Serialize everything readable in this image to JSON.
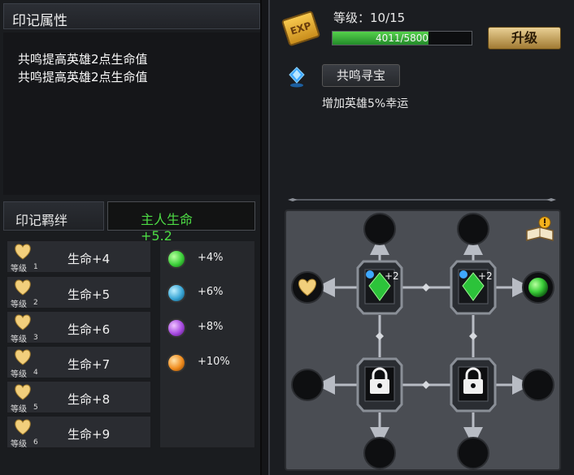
{
  "left": {
    "attr_title": "印记属性",
    "attr_lines": [
      "共鸣提高英雄2点生命值",
      "共鸣提高英雄2点生命值"
    ],
    "bond_title": "印记羁绊",
    "bond_value": "主人生命+5.2",
    "rows": [
      {
        "level_label": "等级",
        "level": "1",
        "hp": "生命+4"
      },
      {
        "level_label": "等级",
        "level": "2",
        "hp": "生命+5"
      },
      {
        "level_label": "等级",
        "level": "3",
        "hp": "生命+6"
      },
      {
        "level_label": "等级",
        "level": "4",
        "hp": "生命+7"
      },
      {
        "level_label": "等级",
        "level": "5",
        "hp": "生命+8"
      },
      {
        "level_label": "等级",
        "level": "6",
        "hp": "生命+9"
      }
    ],
    "gems": [
      {
        "pct": "+4%",
        "color": "#3ccf3a"
      },
      {
        "pct": "+6%",
        "color": "#3aa6d6"
      },
      {
        "pct": "+8%",
        "color": "#a64ae0"
      },
      {
        "pct": "+10%",
        "color": "#f08c1e"
      }
    ]
  },
  "right": {
    "exp_badge": "EXP",
    "level_text": "等级：10/15",
    "exp_current": 4011,
    "exp_max": 5800,
    "exp_text": "4011/5800",
    "upgrade_label": "升级",
    "resonate_label": "共鸣寻宝",
    "resonate_desc": "增加英雄5%幸运",
    "board": {
      "gem_plus": "+2",
      "left_end": "heart-icon",
      "right_end": "green-gem-icon",
      "lock_icon": "padlock-icon",
      "book_icon": "book-alert-icon"
    }
  },
  "colors": {
    "accent_green": "#4ddc45",
    "heart": "#f2cf7c",
    "upgrade_button": "#d6b468"
  }
}
